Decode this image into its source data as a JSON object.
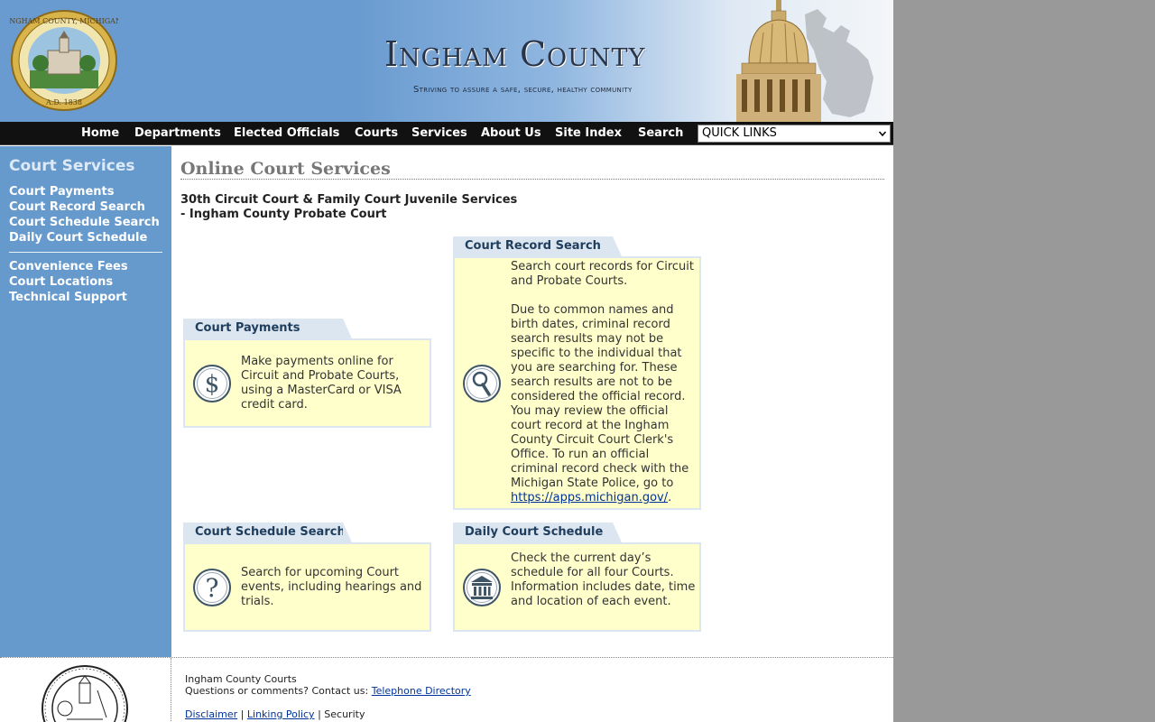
{
  "header": {
    "title": "Ingham County",
    "tagline": "Striving to assure a safe, secure, healthy community",
    "seal_text": "INGHAM COUNTY, MICHIGAN",
    "seal_year": "A.D. 1838"
  },
  "nav": {
    "items": [
      "Home",
      "Departments",
      "Elected Officials",
      "Courts",
      "Services",
      "About Us",
      "Site Index",
      "Search"
    ],
    "quick_links": "QUICK LINKS"
  },
  "sidebar": {
    "title": "Court Services",
    "group1": [
      "Court Payments",
      "Court Record Search",
      "Court Schedule Search",
      "Daily Court Schedule"
    ],
    "group2": [
      "Convenience Fees",
      "Court Locations",
      "Technical Support"
    ]
  },
  "main": {
    "title": "Online Court Services",
    "subhead1": "30th Circuit Court & Family Court Juvenile Services",
    "subhead2": "- Ingham County Probate Court",
    "cards": {
      "payments": {
        "title": "Court Payments",
        "text": "Make payments online for Circuit and Probate Courts, using a MasterCard or VISA credit card."
      },
      "record": {
        "title": "Court Record Search",
        "text1": "Search court records for Circuit and Probate Courts.",
        "text2": "Due to common names and birth dates, criminal record search results may not be specific to the individual that you are searching for. These search results are not to be considered the official record. You may review the official court record at the Ingham County Circuit Court Clerk's Office. To run an official criminal record check with the Michigan State Police, go to",
        "link": "https://apps.michigan.gov/",
        "link_suffix": "."
      },
      "schedule_search": {
        "title": "Court Schedule Search",
        "text": "Search for upcoming Court events, including hearings and trials."
      },
      "daily": {
        "title": "Daily Court Schedule",
        "text": "Check the current day’s schedule for all four Courts. Information includes date, time and location of each event."
      }
    }
  },
  "footer": {
    "line1": "Ingham County Courts",
    "line2": "Questions or comments? Contact us:",
    "telephone_link": "Telephone Directory",
    "disclaimer": "Disclaimer",
    "sep": "|",
    "linking": "Linking Policy",
    "security": "| Security"
  },
  "colors": {
    "sidebar": "#6699cc",
    "card_bg": "#ffffcc",
    "card_tab": "#dce6f1",
    "navbar": "#111111"
  }
}
